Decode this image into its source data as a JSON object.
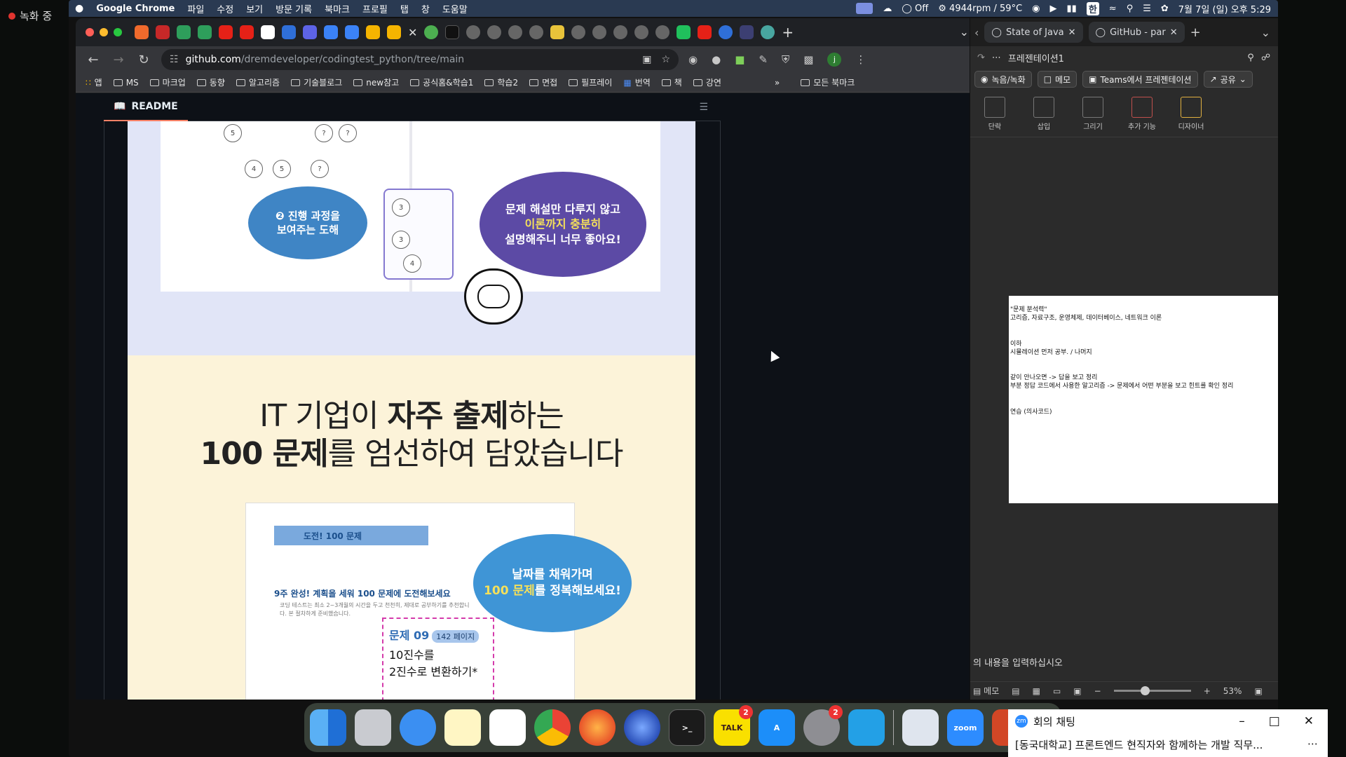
{
  "recording": {
    "label": "녹화 중"
  },
  "menubar": {
    "app": "Google Chrome",
    "items": [
      "파일",
      "수정",
      "보기",
      "방문 기록",
      "북마크",
      "프로필",
      "탭",
      "창",
      "도움말"
    ],
    "status": {
      "vpn": "Off",
      "fan": "4944rpm / 59°C",
      "datetime": "7월 7일 (일) 오후 5:29"
    }
  },
  "chrome": {
    "url_host": "github.com",
    "url_path": "/dremdeveloper/codingtest_python/tree/main",
    "bookmarks": [
      "앱",
      "MS",
      "마크업",
      "동향",
      "알고리즘",
      "기술블로그",
      "new참고",
      "공식홈&학습1",
      "학습2",
      "면접",
      "필프레이",
      "번역",
      "책",
      "강연"
    ],
    "all_bookmarks": "모든 북마크",
    "readme_tab": "README"
  },
  "readme": {
    "bubble1_line1": "❷ 진행 과정을",
    "bubble1_line2": "보여주는 도해",
    "bubble2_line1": "문제 해설만 다루지 않고",
    "bubble2_line2": "이론까지 충분히",
    "bubble2_line3": "설명해주니 너무 좋아요!",
    "headline_pre1": "IT 기업이 ",
    "headline_bold1": "자주 출제",
    "headline_post1": "하는",
    "headline_bold2": "100 문제",
    "headline_post2": "를 엄선하여 담았습니다",
    "inner_tag": "도전! 100 문제",
    "inner_title": "9주 완성! 계획을 세워 100 문제에 도전해보세요",
    "inner_text": "코딩 테스트는 최소 2~3개월의 시간을 두고 천천히, 제대로 공부하기를 추천합니다. 본 절차하게 준비했습니다.",
    "bubble3_line1": "날짜를 채워가며",
    "bubble3_hl": "100 문제",
    "bubble3_rest": "를 정복해보세요!",
    "problem_no": "문제 09",
    "problem_page": "142 페이지",
    "problem_line1": "10진수를",
    "problem_line2": "2진수로 변환하기*"
  },
  "ppt": {
    "tab1": "State of Java",
    "tab2": "GitHub - par",
    "doc_title": "프레젠테이션1",
    "btn_record": "녹음/녹화",
    "btn_memo": "메모",
    "btn_teams": "Teams에서 프레젠테이션",
    "btn_share": "공유",
    "ribbon": [
      "단락",
      "삽입",
      "그리기",
      "추가 기능",
      "디자이너"
    ],
    "slide_lines": [
      "\"문제 분석력\"",
      "고리즘, 자료구조, 운영체제, 데이터베이스, 네트워크 이론",
      "",
      "",
      "이하",
      "시뮬레이션 먼저 공부. / 나머지",
      "",
      "",
      "같이 안나오면 -> 답을 보고 정리",
      "부분 정답 코드에서 사용한 알고리즘 -> 문제에서 어떤 부분을 보고 힌트를 확인 정리",
      "",
      "",
      "연습 (의사코드)"
    ],
    "notes_placeholder": "의 내용을 입력하십시오",
    "status_memo": "메모",
    "zoom": "53%"
  },
  "dock": {
    "talk_label": "TALK",
    "talk_badge": "2",
    "settings_badge": "2",
    "zoom_label": "zoom"
  },
  "zoom_chat": {
    "title": "회의 채팅",
    "message": "[동국대학교] 프론트엔드 현직자와 함께하는 개발 직무..."
  }
}
